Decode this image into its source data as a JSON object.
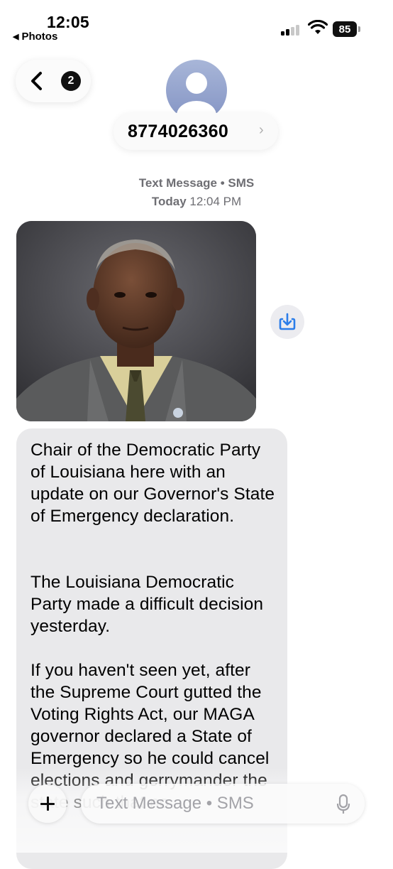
{
  "status_bar": {
    "time": "12:05",
    "back_app": "Photos",
    "battery": "85"
  },
  "header": {
    "back_badge": "2",
    "contact_name": "8774026360"
  },
  "thread": {
    "service_label": "Text Message • SMS",
    "day": "Today",
    "time": "12:04 PM",
    "photo": "portrait photo of a man in a suit and tie",
    "message_paragraphs": [
      "Chair of the Democratic Party of Louisiana here with an update on our Governor's State of Emergency declaration.",
      "The Louisiana Democratic Party made a difficult decision yesterday.",
      "If you haven't seen yet, after the Supreme Court gutted the Voting Rights Act, our MAGA governor declared a State of Emergency so he could cancel elections and gerrymander the state such that no"
    ]
  },
  "compose": {
    "placeholder": "Text Message • SMS"
  },
  "icons": [
    "back-arrow-icon",
    "chevron-left-icon",
    "person-avatar-icon",
    "chevron-right-icon",
    "save-image-icon",
    "plus-icon",
    "microphone-icon",
    "signal-icon",
    "wifi-icon",
    "battery-icon"
  ]
}
